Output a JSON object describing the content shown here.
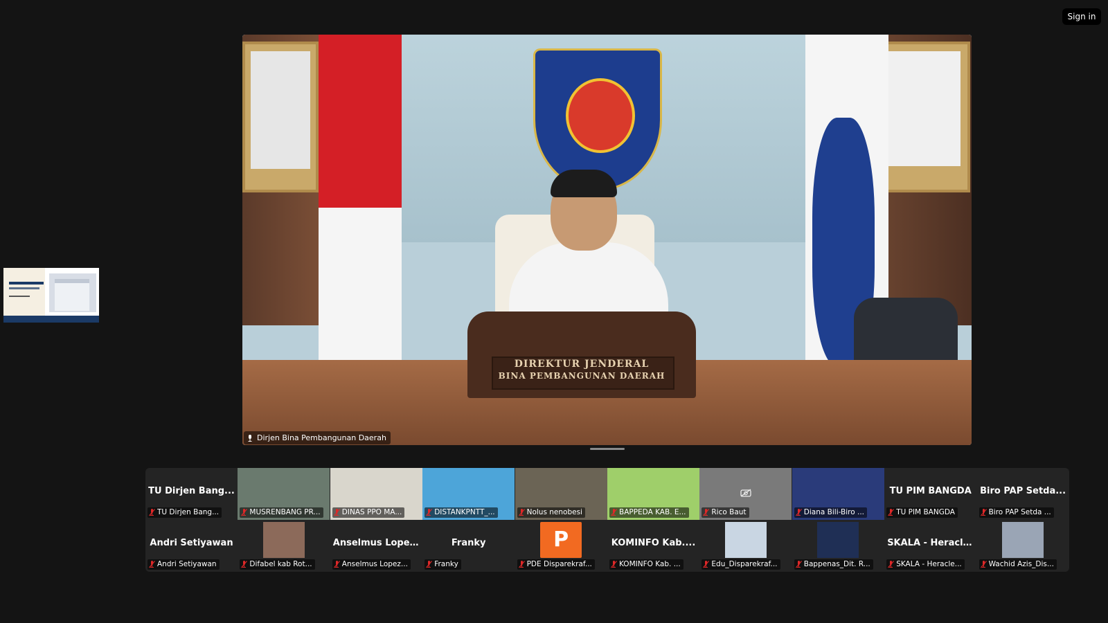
{
  "header": {
    "sign_in_label": "Sign in"
  },
  "main_video": {
    "speaker_name": "Dirjen Bina Pembangunan Daerah",
    "nameplate_line1": "DIREKTUR JENDERAL",
    "nameplate_line2": "BINA PEMBANGUNAN DAERAH"
  },
  "gallery": {
    "row1": [
      {
        "big": "TU Dirjen Bang...",
        "label": "TU Dirjen Bang..."
      },
      {
        "big": "",
        "label": "MUSRENBANG PR..."
      },
      {
        "big": "",
        "label": "DINAS PPO MA..."
      },
      {
        "big": "",
        "label": "DISTANKPNTT_..."
      },
      {
        "big": "",
        "label": "Nolus nenobesi"
      },
      {
        "big": "",
        "label": "BAPPEDA KAB. E..."
      },
      {
        "big": "",
        "label": "Rico Baut"
      },
      {
        "big": "",
        "label": "Diana Bili-Biro ..."
      },
      {
        "big": "TU PIM BANGDA",
        "label": "TU PIM BANGDA"
      },
      {
        "big": "Biro PAP Setda...",
        "label": "Biro PAP Setda ..."
      }
    ],
    "row2": [
      {
        "big": "Andri Setiyawan",
        "label": "Andri Setiyawan"
      },
      {
        "big": "",
        "label": "Difabel kab Rot..."
      },
      {
        "big": "Anselmus Lopez...",
        "label": "Anselmus Lopez..."
      },
      {
        "big": "Franky",
        "label": "Franky"
      },
      {
        "big": "",
        "label": "PDE Disparekraf...",
        "avatar_letter": "P"
      },
      {
        "big": "KOMINFO Kab....",
        "label": "KOMINFO Kab. ..."
      },
      {
        "big": "",
        "label": "Edu_Disparekraf..."
      },
      {
        "big": "",
        "label": "Bappenas_Dit. R..."
      },
      {
        "big": "SKALA - Heracle...",
        "label": "SKALA - Heracle..."
      },
      {
        "big": "",
        "label": "Wachid Azis_Dis..."
      }
    ]
  },
  "colors": {
    "background": "#141414",
    "gallery_bg": "#242424",
    "muted_icon": "#e02828",
    "avatar_orange": "#f26a21"
  },
  "icons": {
    "muted": "mic-muted-icon",
    "mic": "mic-icon",
    "camera_off": "camera-off-icon"
  }
}
